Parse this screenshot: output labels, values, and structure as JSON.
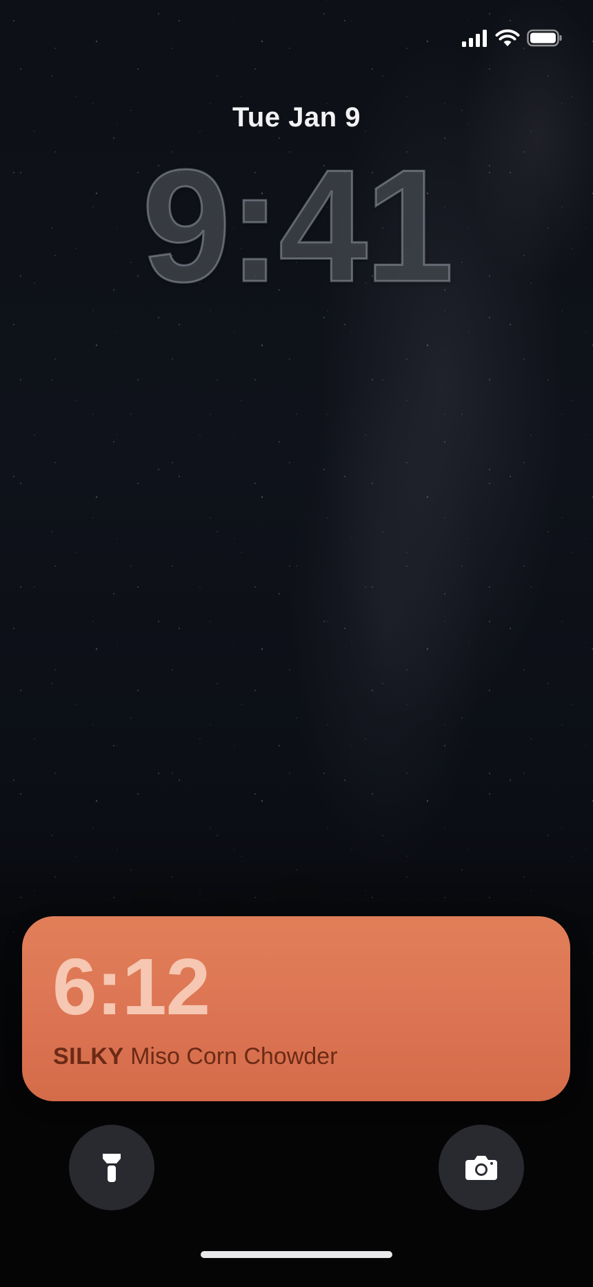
{
  "status_bar": {
    "icons": [
      "signal-icon",
      "wifi-icon",
      "battery-icon"
    ]
  },
  "lock_screen": {
    "date": "Tue Jan 9",
    "time": "9:41"
  },
  "live_activity": {
    "timer": "6:12",
    "tag": "SILKY",
    "recipe": "Miso Corn Chowder",
    "colors": {
      "card": "#dc7453",
      "timer_text": "#f6c7b2",
      "label_text": "#6b2a16"
    }
  },
  "quick_actions": {
    "left_icon": "flashlight-icon",
    "right_icon": "camera-icon"
  }
}
